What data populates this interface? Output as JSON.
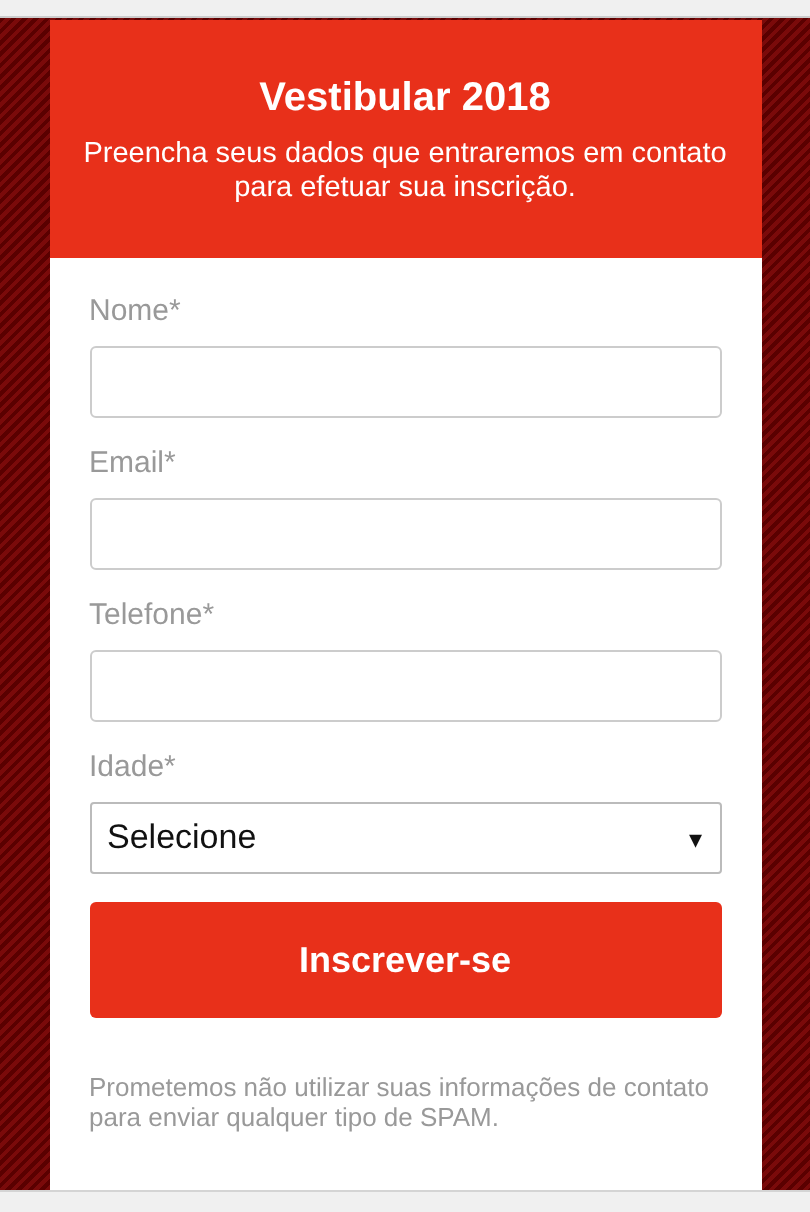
{
  "header": {
    "title": "Vestibular 2018",
    "subtitle": "Preencha seus dados que entraremos em contato para efetuar sua inscrição."
  },
  "fields": [
    {
      "kind": "input",
      "label": "Nome*"
    },
    {
      "kind": "input",
      "label": "Email*"
    },
    {
      "kind": "input",
      "label": "Telefone*"
    },
    {
      "kind": "select",
      "label": "Idade*",
      "value": "Selecione",
      "arrow": "▾"
    }
  ],
  "submit": "Inscrever-se",
  "disclaimer": "Prometemos não utilizar suas informações de contato para enviar qualquer tipo de SPAM."
}
